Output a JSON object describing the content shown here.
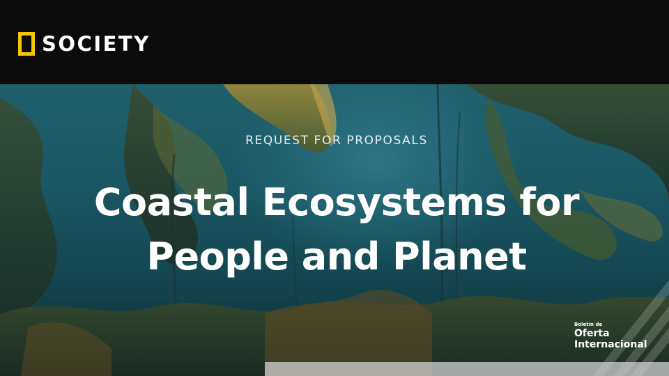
{
  "brand": {
    "name": "SOCIETY",
    "accent_color": "#f7c600",
    "mark": "yellow-rectangle-frame"
  },
  "hero": {
    "eyebrow": "REQUEST FOR PROPOSALS",
    "title_line1": "Coastal Ecosystems for",
    "title_line2": "People and Planet",
    "background": "underwater kelp forest"
  },
  "bulletin": {
    "small_label": "Boletín de",
    "line1": "Oferta",
    "line2": "Internacional"
  }
}
